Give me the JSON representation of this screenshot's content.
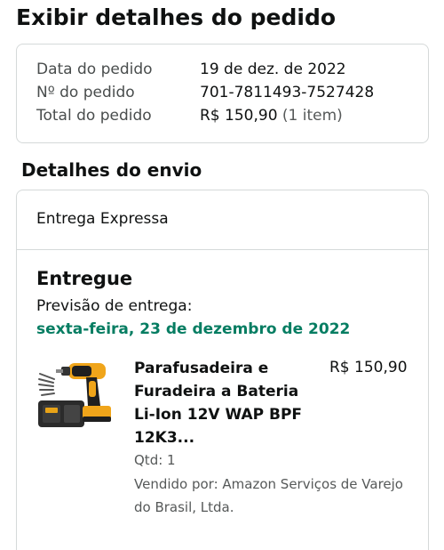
{
  "page": {
    "title": "Exibir detalhes do pedido"
  },
  "summary": {
    "date_label": "Data do pedido",
    "date_value": "19 de dez. de 2022",
    "number_label": "Nº do pedido",
    "number_value": "701-7811493-7527428",
    "total_label": "Total do pedido",
    "total_value": "R$ 150,90",
    "total_items": "(1 item)"
  },
  "shipping": {
    "section_title": "Detalhes do envio",
    "method": "Entrega Expressa",
    "status": "Entregue",
    "eta_label": "Previsão de entrega:",
    "eta_date": "sexta-feira, 23 de dezembro de 2022",
    "status_color": "#067d62"
  },
  "item": {
    "title": "Parafusadeira e Furadeira a Bateria Li-Ion 12V WAP BPF 12K3...",
    "price": "R$ 150,90",
    "quantity": "Qtd: 1",
    "seller": "Vendido por: Amazon Serviços de Varejo do Brasil, Ltda.",
    "image_icon": "drill-kit-icon"
  }
}
